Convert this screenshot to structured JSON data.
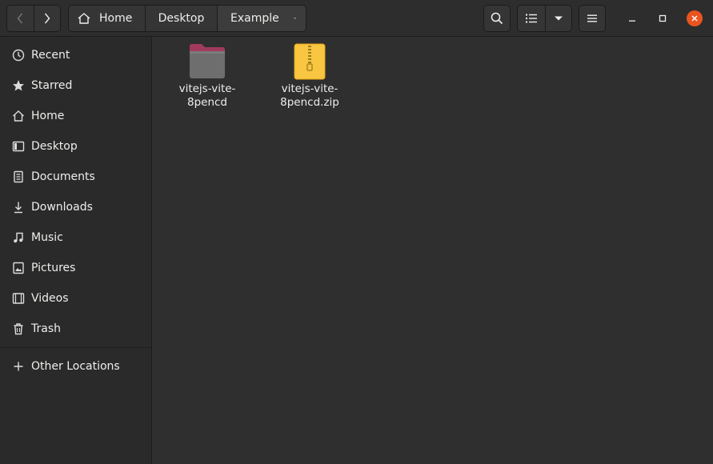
{
  "header": {
    "breadcrumbs": [
      "Home",
      "Desktop",
      "Example"
    ]
  },
  "sidebar": {
    "items": [
      {
        "label": "Recent",
        "icon": "clock-icon"
      },
      {
        "label": "Starred",
        "icon": "star-icon"
      },
      {
        "label": "Home",
        "icon": "home-icon"
      },
      {
        "label": "Desktop",
        "icon": "desktop-icon"
      },
      {
        "label": "Documents",
        "icon": "document-icon"
      },
      {
        "label": "Downloads",
        "icon": "download-icon"
      },
      {
        "label": "Music",
        "icon": "music-icon"
      },
      {
        "label": "Pictures",
        "icon": "picture-icon"
      },
      {
        "label": "Videos",
        "icon": "video-icon"
      },
      {
        "label": "Trash",
        "icon": "trash-icon"
      }
    ],
    "other_locations": "Other Locations"
  },
  "files": [
    {
      "name_line1": "vitejs-vite-",
      "name_line2": "8pencd",
      "type": "folder",
      "color": "#a23a5e"
    },
    {
      "name_line1": "vitejs-vite-",
      "name_line2": "8pencd.zip",
      "type": "archive",
      "color": "#f8c640"
    }
  ],
  "colors": {
    "accent": "#e95420",
    "background": "#2f2f2f",
    "sidebar": "#2a2a2a"
  }
}
